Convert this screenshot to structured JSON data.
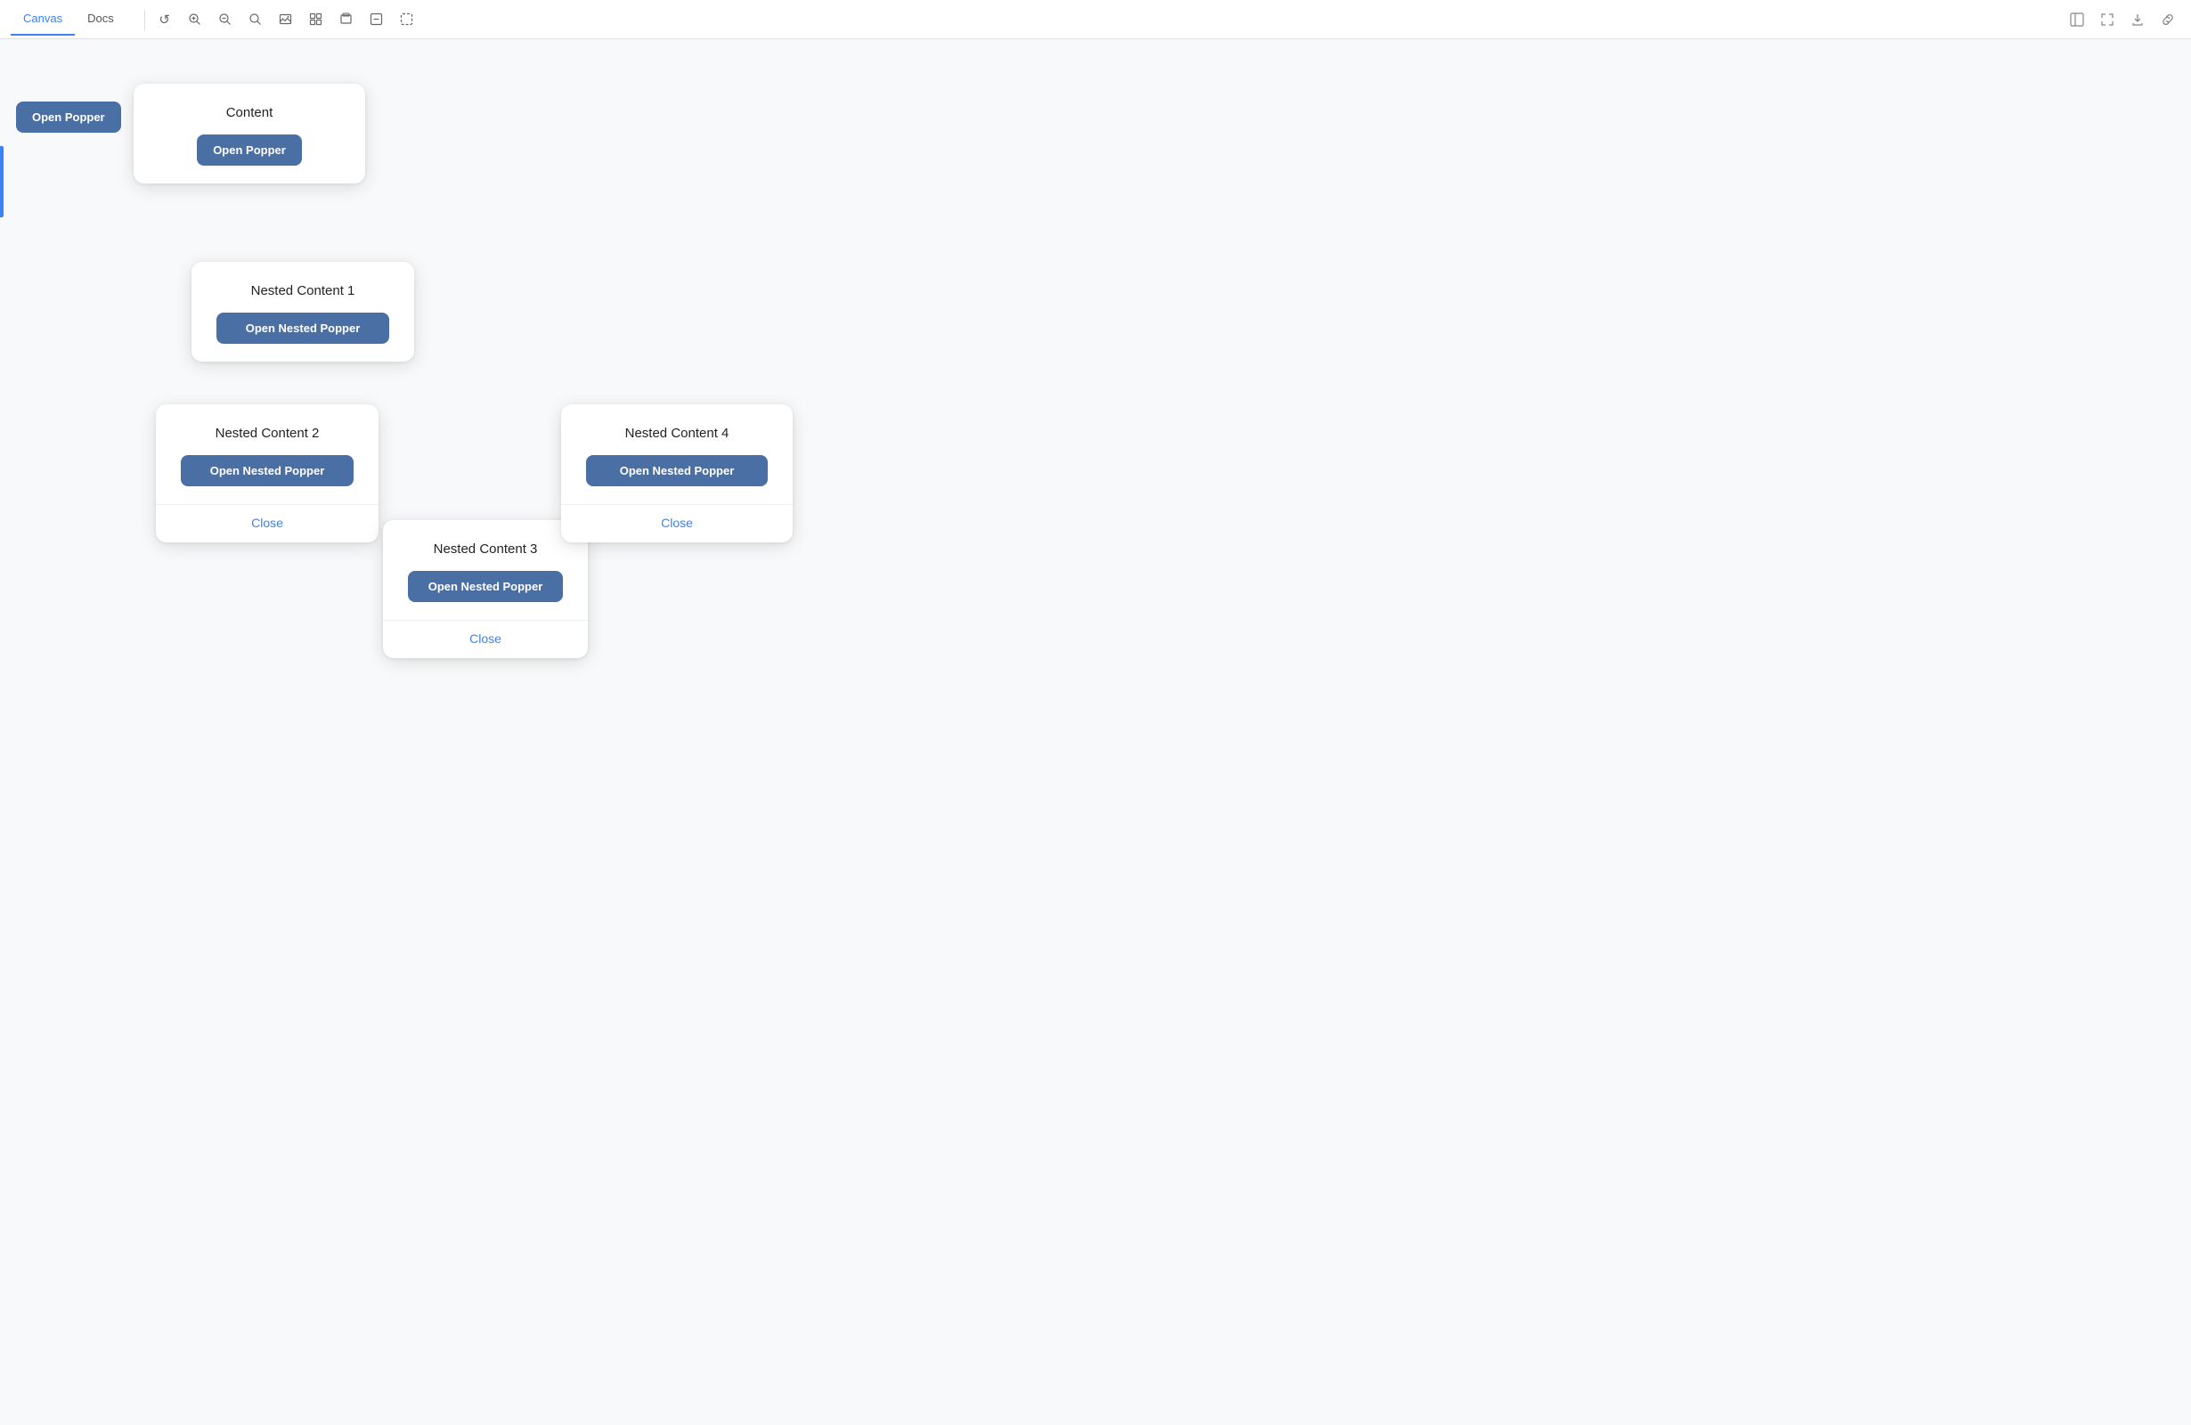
{
  "topbar": {
    "tabs": [
      {
        "id": "canvas",
        "label": "Canvas",
        "active": true
      },
      {
        "id": "docs",
        "label": "Docs",
        "active": false
      }
    ],
    "icons": [
      {
        "id": "refresh",
        "symbol": "↺"
      },
      {
        "id": "zoom-in",
        "symbol": "⊕"
      },
      {
        "id": "zoom-out",
        "symbol": "⊖"
      },
      {
        "id": "search",
        "symbol": "⌕"
      },
      {
        "id": "image",
        "symbol": "⬜"
      },
      {
        "id": "grid",
        "symbol": "⊞"
      },
      {
        "id": "layers",
        "symbol": "❑"
      },
      {
        "id": "minus-square",
        "symbol": "⊟"
      },
      {
        "id": "selection",
        "symbol": "⬚"
      }
    ],
    "right_icons": [
      {
        "id": "panel",
        "symbol": "▤"
      },
      {
        "id": "expand",
        "symbol": "⤢"
      },
      {
        "id": "export",
        "symbol": "⬡"
      },
      {
        "id": "link",
        "symbol": "🔗"
      }
    ]
  },
  "standalone_button": {
    "label": "Open Popper"
  },
  "card_main": {
    "title": "Content",
    "button_label": "Open Popper"
  },
  "card_nested1": {
    "title": "Nested Content 1",
    "button_label": "Open Nested Popper"
  },
  "card_nested2": {
    "title": "Nested Content 2",
    "button_label": "Open Nested Popper",
    "close_label": "Close"
  },
  "card_nested3": {
    "title": "Nested Content 3",
    "button_label": "Open Nested Popper",
    "close_label": "Close"
  },
  "card_nested4": {
    "title": "Nested Content 4",
    "button_label": "Open Nested Popper",
    "close_label": "Close"
  }
}
